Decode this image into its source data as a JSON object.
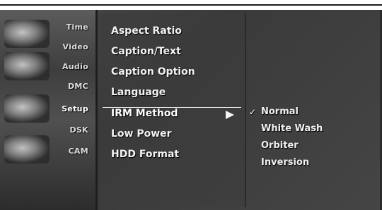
{
  "sidebar": {
    "items": [
      {
        "label": "Time"
      },
      {
        "label": "Video"
      },
      {
        "label": "Audio"
      },
      {
        "label": "DMC"
      },
      {
        "label": "Setup"
      },
      {
        "label": "DSK"
      },
      {
        "label": "CAM"
      }
    ],
    "selected_index": 4
  },
  "menu": {
    "items": [
      {
        "label": "Aspect Ratio"
      },
      {
        "label": "Caption/Text"
      },
      {
        "label": "Caption Option"
      },
      {
        "label": "Language"
      },
      {
        "label": "IRM Method"
      },
      {
        "label": "Low Power"
      },
      {
        "label": "HDD Format"
      }
    ],
    "selected_index": 4
  },
  "submenu": {
    "options": [
      {
        "label": "Normal",
        "checked": true
      },
      {
        "label": "White Wash",
        "checked": false
      },
      {
        "label": "Orbiter",
        "checked": false
      },
      {
        "label": "Inversion",
        "checked": false
      }
    ],
    "check_glyph": "✓"
  },
  "colors": {
    "background": "#444444",
    "text": "#f2f2f2",
    "highlight_line": "#e8e8e8"
  }
}
